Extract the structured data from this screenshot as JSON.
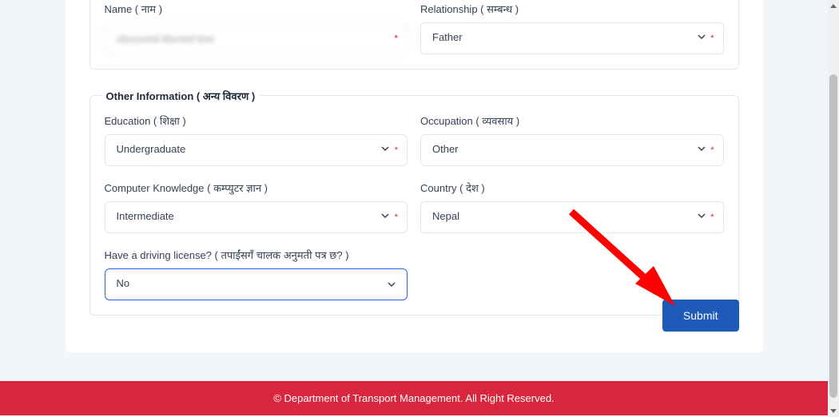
{
  "section1": {
    "name_label": "Name ( नाम )",
    "name_value": "obscured blurred text",
    "relationship_label": "Relationship ( सम्बन्ध )",
    "relationship_value": "Father"
  },
  "section2": {
    "legend": "Other Information ( अन्य विवरण )",
    "education_label": "Education ( शिक्षा )",
    "education_value": "Undergraduate",
    "occupation_label": "Occupation ( व्यवसाय )",
    "occupation_value": "Other",
    "computer_label": "Computer Knowledge ( कम्प्युटर ज्ञान )",
    "computer_value": "Intermediate",
    "country_label": "Country ( देश )",
    "country_value": "Nepal",
    "license_label": "Have a driving license? ( तपाईंसगँ चालक अनुमती पत्र छ? )",
    "license_value": "No"
  },
  "submit_label": "Submit",
  "footer_text": "© Department of Transport Management. All Right Reserved."
}
